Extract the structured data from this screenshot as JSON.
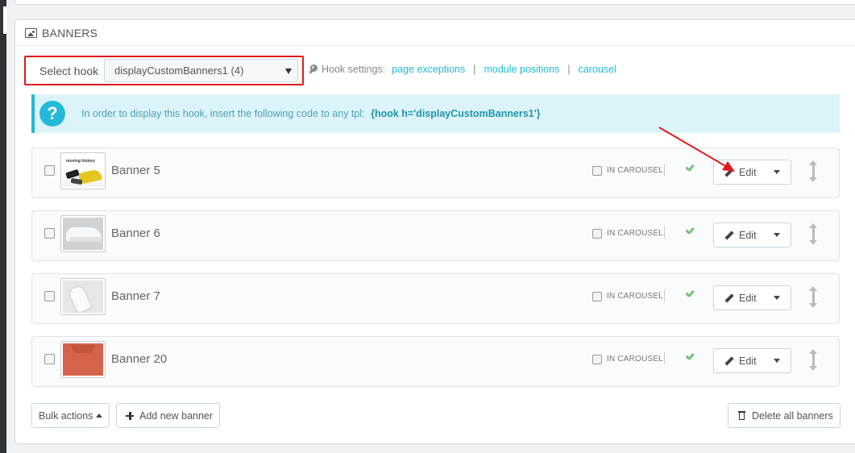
{
  "panel": {
    "title": "BANNERS"
  },
  "hook": {
    "label": "Select hook",
    "selected": "displayCustomBanners1 (4)"
  },
  "hook_settings": {
    "label": "Hook settings:",
    "links": [
      "page exceptions",
      "module positions",
      "carousel"
    ],
    "separator": "|"
  },
  "info": {
    "icon": "?",
    "text": "In order to display this hook, insert the following code to any tpl:",
    "code": "{hook h='displayCustomBanners1'}"
  },
  "banners": [
    {
      "name": "Banner 5",
      "carousel_label": "IN CAROUSEL",
      "edit_label": "Edit"
    },
    {
      "name": "Banner 6",
      "carousel_label": "IN CAROUSEL",
      "edit_label": "Edit"
    },
    {
      "name": "Banner 7",
      "carousel_label": "IN CAROUSEL",
      "edit_label": "Edit"
    },
    {
      "name": "Banner 20",
      "carousel_label": "IN CAROUSEL",
      "edit_label": "Edit"
    }
  ],
  "thumb_text": "moving history",
  "footer": {
    "bulk_actions": "Bulk actions",
    "add_banner": "Add new banner",
    "delete_all": "Delete all banners"
  },
  "colors": {
    "accent": "#25b9d7",
    "highlight": "#e0191d",
    "success": "#72c279"
  }
}
